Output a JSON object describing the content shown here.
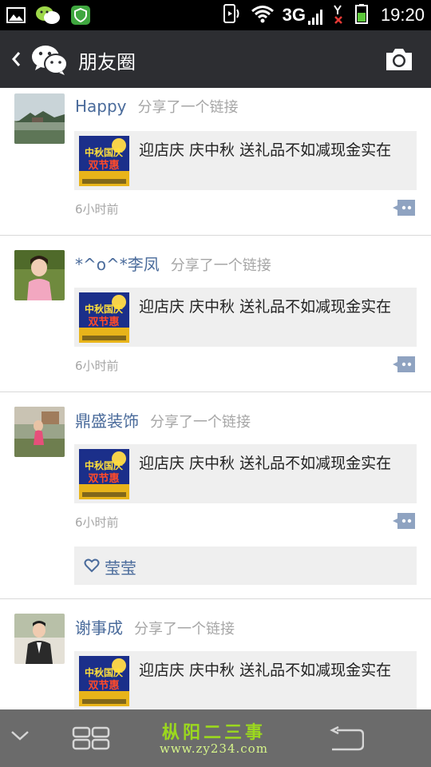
{
  "status_bar": {
    "network": "3G",
    "time": "19:20",
    "icons": [
      "image-icon",
      "wechat-icon",
      "shield-icon",
      "vibrate-icon",
      "wifi-icon",
      "signal-icon",
      "no-sim-icon",
      "battery-icon"
    ]
  },
  "header": {
    "title": "朋友圈",
    "back_icon": "chevron-left-icon",
    "logo_icon": "wechat-logo-icon",
    "camera_icon": "camera-icon",
    "bg_color": "#2d2e32"
  },
  "posts": [
    {
      "name": "Happy",
      "action": "分享了一个链接",
      "link_title": "迎店庆 庆中秋 送礼品不如减现金实在",
      "thumb_text": "中秋国庆 双节惠",
      "time": "6小时前"
    },
    {
      "name": "*^o^*李凤",
      "action": "分享了一个链接",
      "link_title": "迎店庆 庆中秋 送礼品不如减现金实在",
      "thumb_text": "中秋国庆 双节惠",
      "time": "6小时前"
    },
    {
      "name": "鼎盛装饰",
      "action": "分享了一个链接",
      "link_title": "迎店庆 庆中秋 送礼品不如减现金实在",
      "thumb_text": "中秋国庆 双节惠",
      "time": "6小时前",
      "likes": [
        "莹莹"
      ]
    },
    {
      "name": "谢事成",
      "action": "分享了一个链接",
      "link_title": "迎店庆 庆中秋 送礼品不如减现金实在",
      "thumb_text": "中秋国庆 双节惠"
    }
  ],
  "nav_bar": {
    "icons": [
      "chevron-down-icon",
      "recent-apps-icon",
      "back-icon"
    ],
    "watermark_title": "枞阳二三事",
    "watermark_url": "www.zy234.com"
  },
  "colors": {
    "name_link": "#4a6b9b",
    "muted": "#a6a6a6",
    "card_bg": "#efefef",
    "nav_bg": "#6b6b6b"
  }
}
